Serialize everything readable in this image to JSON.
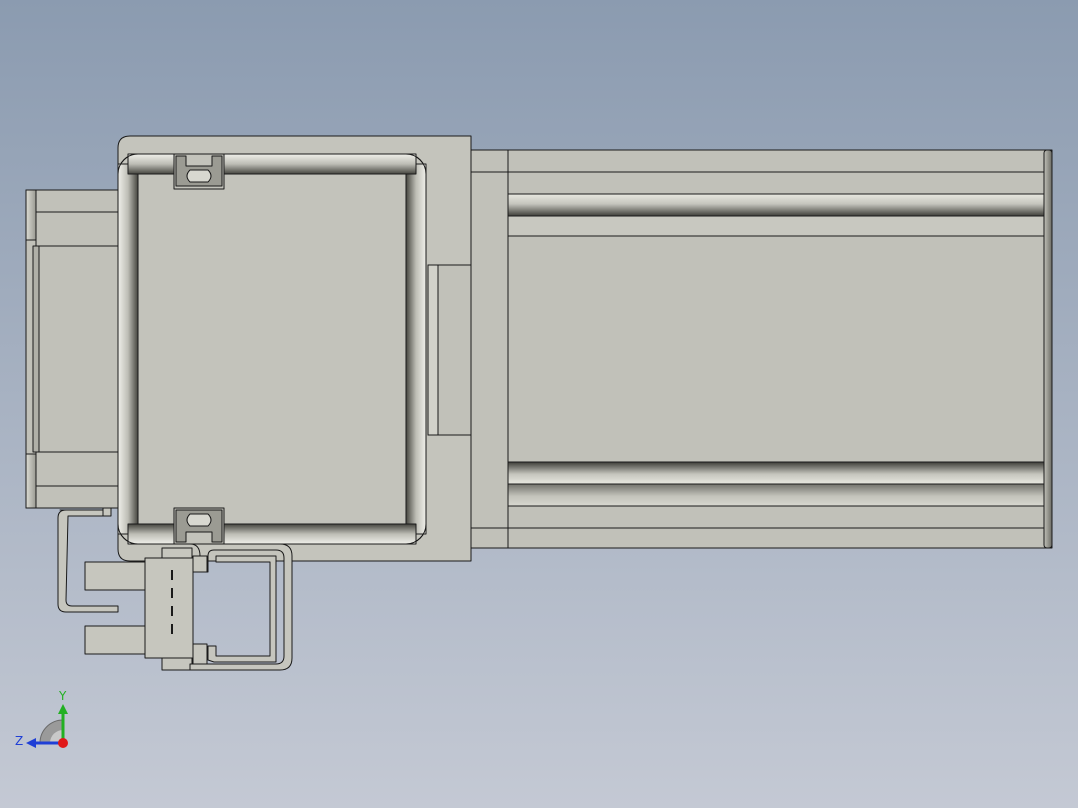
{
  "viewport": {
    "background_top": "#8b9bb0",
    "background_bottom": "#c3c8d3",
    "part_fill": "#c1c1b9",
    "part_stroke": "#1a1a1a",
    "shade_dark": "#4f4f49",
    "shade_light": "#e6e6de"
  },
  "triad": {
    "y_label": "Y",
    "z_label": "Z",
    "y_color": "#22b022",
    "z_color": "#1f3fd6",
    "x_color": "#e01818"
  }
}
